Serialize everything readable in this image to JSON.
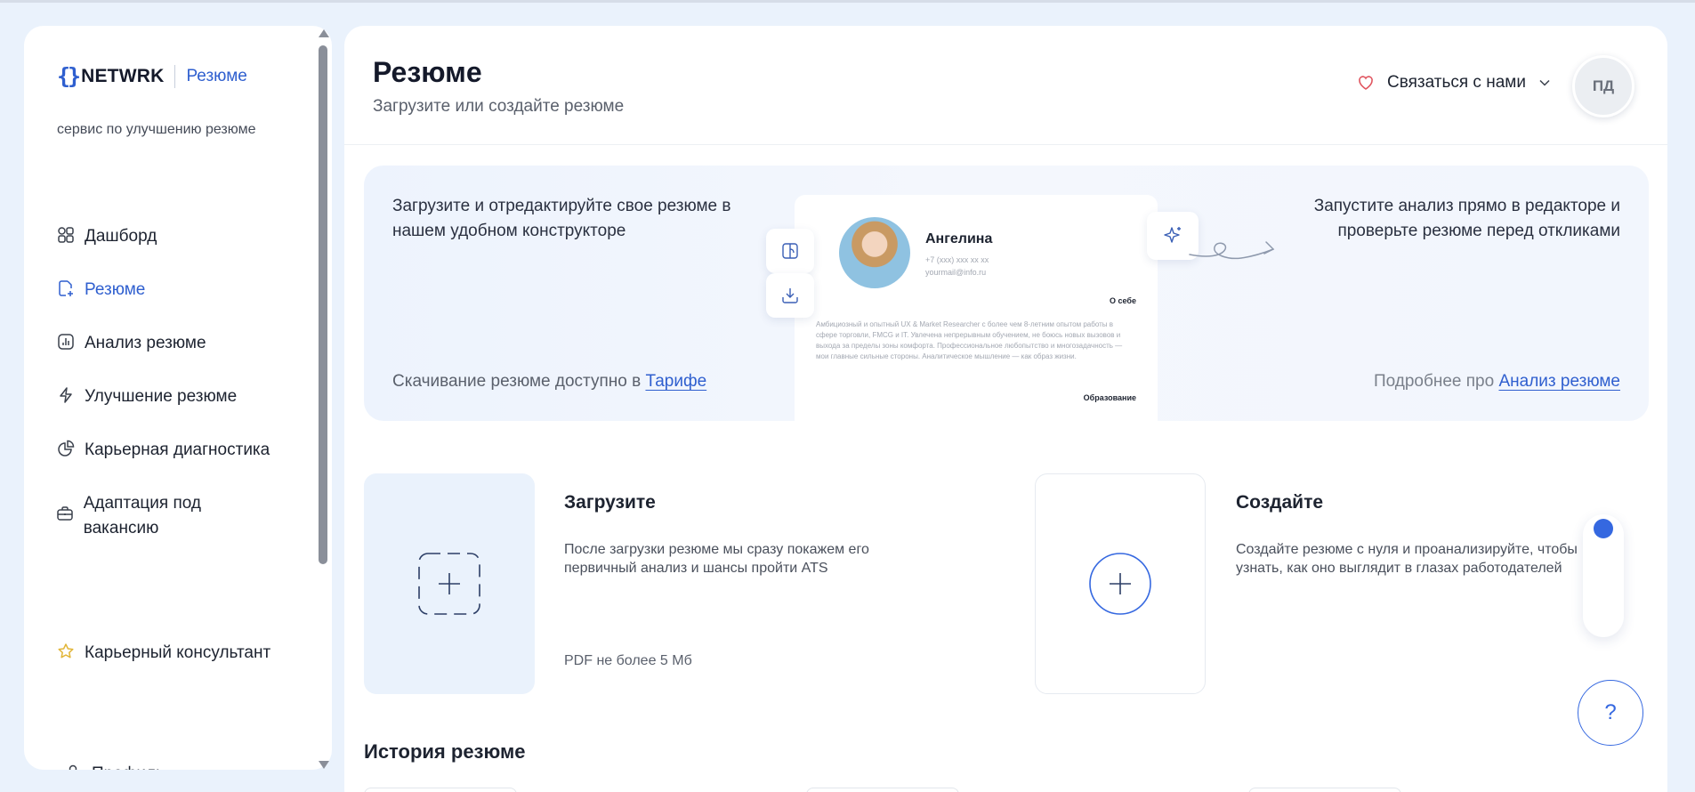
{
  "sidebar": {
    "logo_text": "NETWRK",
    "logo_braces": "{}",
    "logo_sub": "Резюме",
    "tagline": "сервис по улучшению резюме",
    "items": [
      {
        "label": "Дашборд",
        "icon": "dashboard-icon"
      },
      {
        "label": "Резюме",
        "icon": "resume-icon",
        "active": true
      },
      {
        "label": "Анализ резюме",
        "icon": "chart-icon"
      },
      {
        "label": "Улучшение резюме",
        "icon": "lightning-icon"
      },
      {
        "label": "Карьерная диагностика",
        "icon": "pie-icon"
      },
      {
        "label": "Адаптация под вакансию",
        "icon": "briefcase-icon"
      },
      {
        "label": "Карьерный консультант",
        "icon": "star-icon"
      },
      {
        "label": "Профиль",
        "icon": "user-icon"
      }
    ]
  },
  "header": {
    "title": "Резюме",
    "subtitle": "Загрузите или создайте резюме",
    "contact_label": "Связаться с нами",
    "avatar_initials": "ПД"
  },
  "banner": {
    "left_text": "Загрузите и отредактируйте свое резюме в нашем удобном конструкторе",
    "right_text": "Запустите анализ прямо в редакторе и проверьте резюме перед откликами",
    "download_prefix": "Скачивание резюме доступно в ",
    "download_link": "Тарифе",
    "more_prefix": "Подробнее про ",
    "more_link": "Анализ резюме",
    "cv": {
      "name": "Ангелина",
      "phone": "+7 (xxx) xxx xx xx",
      "email": "yourmail@info.ru",
      "about_title": "О себе",
      "about_text": "Амбициозный и опытный UX & Market Researcher с более чем 8-летним опытом работы в сфере торговли, FMCG и IT. Увлечена непрерывным обучением, не боюсь новых вызовов и выхода за пределы зоны комфорта. Профессиональное любопытство и многозадачность — мои главные сильные стороны. Аналитическое мышление — как образ жизни.",
      "edu_title": "Образование"
    }
  },
  "upload_card": {
    "title": "Загрузите",
    "description": "После загрузки резюме мы сразу покажем его первичный анализ и шансы пройти ATS",
    "note": "PDF не более 5 Мб"
  },
  "create_card": {
    "title": "Создайте",
    "description": "Создайте резюме с нуля  и проанализируйте,  чтобы узнать, как оно выглядит в глазах работодателей"
  },
  "history": {
    "title": "История резюме"
  },
  "help_label": "?",
  "colors": {
    "accent": "#2f5fcf",
    "page_bg": "#eaf2fc",
    "upload_bg": "#eaf2fc"
  }
}
